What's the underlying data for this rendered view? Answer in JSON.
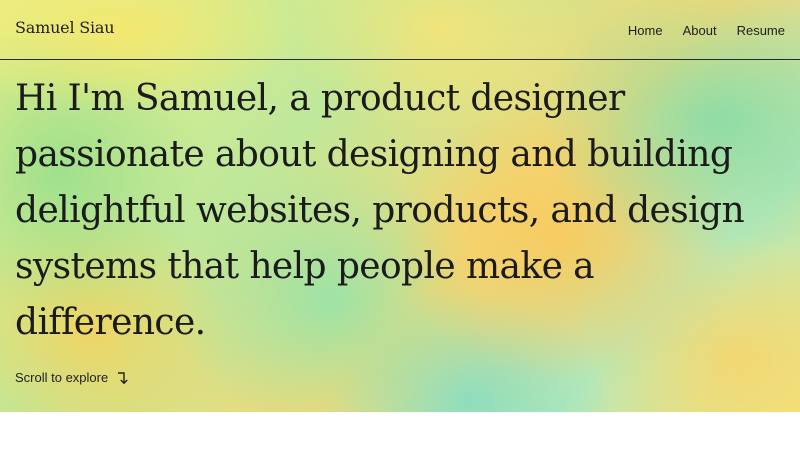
{
  "header": {
    "brand": "Samuel Siau",
    "nav": [
      {
        "label": "Home"
      },
      {
        "label": "About"
      },
      {
        "label": "Resume"
      }
    ]
  },
  "hero": {
    "headline": "Hi I'm Samuel, a product designer passionate about designing and building delightful websites, products, and design systems that help people make a difference.",
    "scroll_label": "Scroll to explore",
    "scroll_icon": "arrow-down-turn-icon"
  },
  "colors": {
    "text": "#1b1b1b",
    "page_background": "#ffffff"
  }
}
